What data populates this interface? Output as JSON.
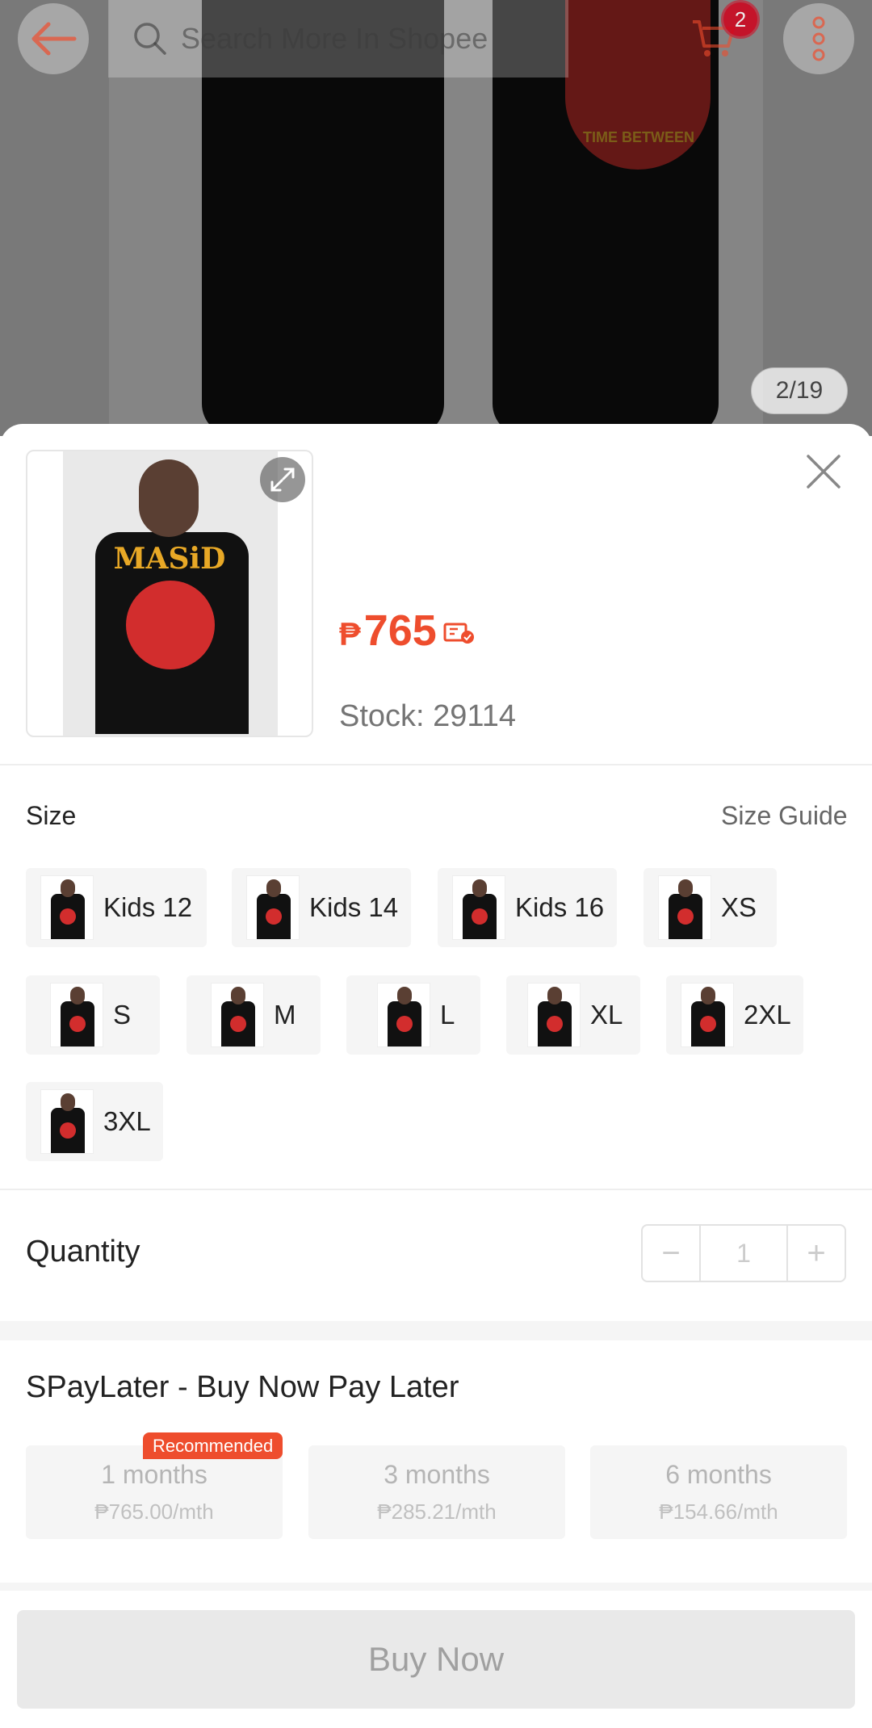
{
  "header": {
    "search_placeholder": "Search More In Shopee",
    "cart_count": "2",
    "image_counter": "2/19"
  },
  "background_graphic_text": "TIME BETWEEN",
  "product": {
    "thumb_text": "MASiD",
    "currency": "₱",
    "price": "765",
    "stock": "Stock: 29114"
  },
  "size": {
    "label": "Size",
    "guide_label": "Size Guide",
    "options": [
      "Kids 12",
      "Kids 14",
      "Kids 16",
      "XS",
      "S",
      "M",
      "L",
      "XL",
      "2XL",
      "3XL"
    ]
  },
  "quantity": {
    "label": "Quantity",
    "value": "1",
    "minus": "−",
    "plus": "+"
  },
  "spaylater": {
    "title": "SPayLater - Buy Now Pay Later",
    "recommended_badge": "Recommended",
    "plans": [
      {
        "term": "1 months",
        "rate": "₱765.00/mth"
      },
      {
        "term": "3 months",
        "rate": "₱285.21/mth"
      },
      {
        "term": "6 months",
        "rate": "₱154.66/mth"
      }
    ]
  },
  "footer": {
    "buy_now": "Buy Now"
  },
  "colors": {
    "accent": "#ee4d2d",
    "badge": "#d0011b"
  }
}
